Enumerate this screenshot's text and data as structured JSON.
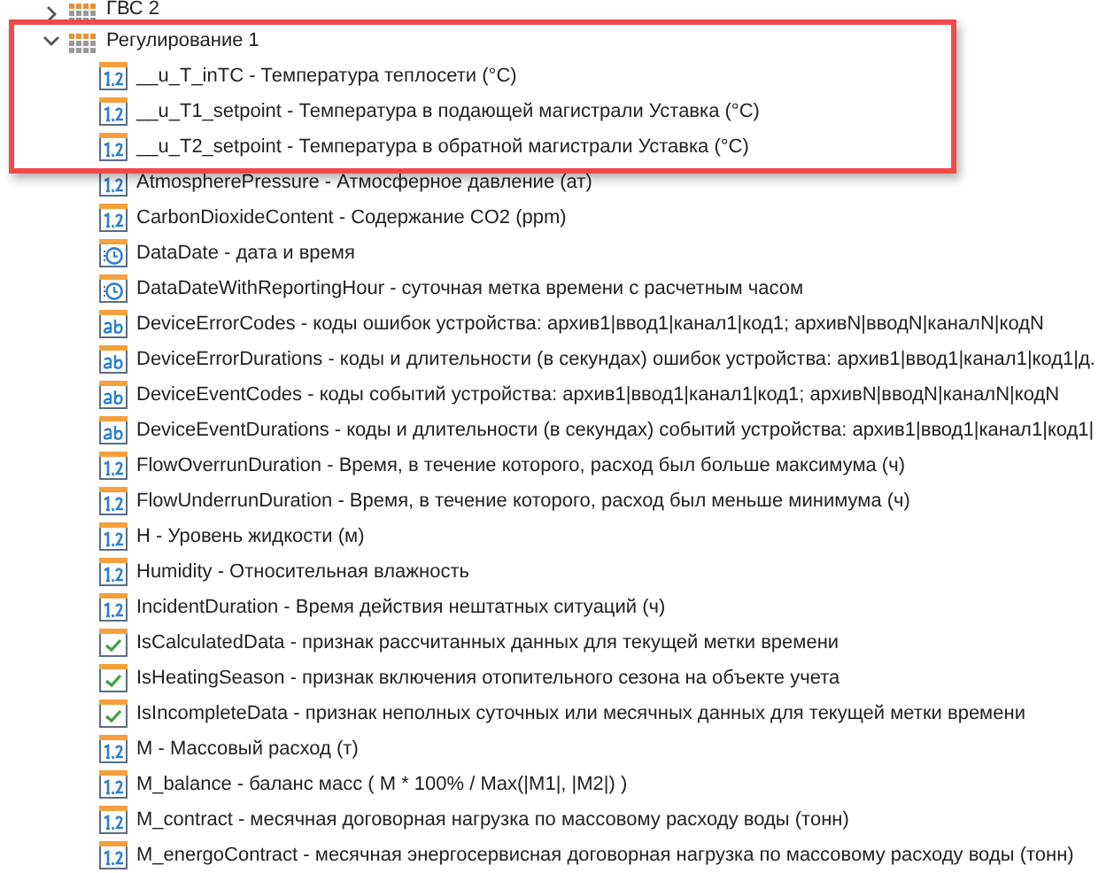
{
  "tree": [
    {
      "label": "ГВС 2",
      "kind": "table",
      "expanded": false,
      "highlighted": false
    },
    {
      "label": "Регулирование 1",
      "kind": "table",
      "expanded": true,
      "highlighted": true,
      "children": [
        {
          "label": "__u_T_inTC - Температура теплосети (°C)",
          "kind": "number",
          "highlighted": true
        },
        {
          "label": "__u_T1_setpoint - Температура в подающей магистрали Уставка (°C)",
          "kind": "number",
          "highlighted": true
        },
        {
          "label": "__u_T2_setpoint - Температура в обратной магистрали Уставка (°C)",
          "kind": "number",
          "highlighted": true
        },
        {
          "label": "AtmospherePressure - Атмосферное давление (ат)",
          "kind": "number",
          "highlighted": false
        },
        {
          "label": "CarbonDioxideContent - Содержание CO2 (ppm)",
          "kind": "number",
          "highlighted": false
        },
        {
          "label": "DataDate - дата и время",
          "kind": "datetime",
          "highlighted": false
        },
        {
          "label": "DataDateWithReportingHour - суточная метка времени с расчетным часом",
          "kind": "datetime",
          "highlighted": false
        },
        {
          "label": "DeviceErrorCodes - коды ошибок устройства: архив1|ввод1|канал1|код1;  архивN|вводN|каналN|кодN",
          "kind": "string",
          "highlighted": false
        },
        {
          "label": "DeviceErrorDurations - коды и длительности (в секундах) ошибок устройства: архив1|ввод1|канал1|код1|д.",
          "kind": "string",
          "highlighted": false
        },
        {
          "label": "DeviceEventCodes - коды событий устройства: архив1|ввод1|канал1|код1;  архивN|вводN|каналN|кодN",
          "kind": "string",
          "highlighted": false
        },
        {
          "label": "DeviceEventDurations - коды и длительности (в секундах) событий устройства: архив1|ввод1|канал1|код1|",
          "kind": "string",
          "highlighted": false
        },
        {
          "label": "FlowOverrunDuration - Время, в течение которого, расход был больше максимума (ч)",
          "kind": "number",
          "highlighted": false
        },
        {
          "label": "FlowUnderrunDuration - Время, в течение которого, расход был меньше минимума (ч)",
          "kind": "number",
          "highlighted": false
        },
        {
          "label": "H - Уровень жидкости (м)",
          "kind": "number",
          "highlighted": false
        },
        {
          "label": "Humidity - Относительная влажность",
          "kind": "number",
          "highlighted": false
        },
        {
          "label": "IncidentDuration - Время действия нештатных ситуаций (ч)",
          "kind": "number",
          "highlighted": false
        },
        {
          "label": "IsCalculatedData - признак рассчитанных данных для текущей метки времени",
          "kind": "boolean",
          "highlighted": false
        },
        {
          "label": "IsHeatingSeason - признак включения отопительного сезона на объекте учета",
          "kind": "boolean",
          "highlighted": false
        },
        {
          "label": "IsIncompleteData - признак неполных суточных или месячных данных для текущей метки времени",
          "kind": "boolean",
          "highlighted": false
        },
        {
          "label": "M - Массовый расход (т)",
          "kind": "number",
          "highlighted": false
        },
        {
          "label": "M_balance - баланс масс ( M * 100% / Max(|M1|, |M2|) )",
          "kind": "number",
          "highlighted": false
        },
        {
          "label": "M_contract - месячная договорная нагрузка по массовому расходу воды (тонн)",
          "kind": "number",
          "highlighted": false
        },
        {
          "label": "M_energoContract - месячная энергосервисная договорная нагрузка по массовому расходу воды (тонн)",
          "kind": "number",
          "highlighted": false
        }
      ]
    }
  ]
}
